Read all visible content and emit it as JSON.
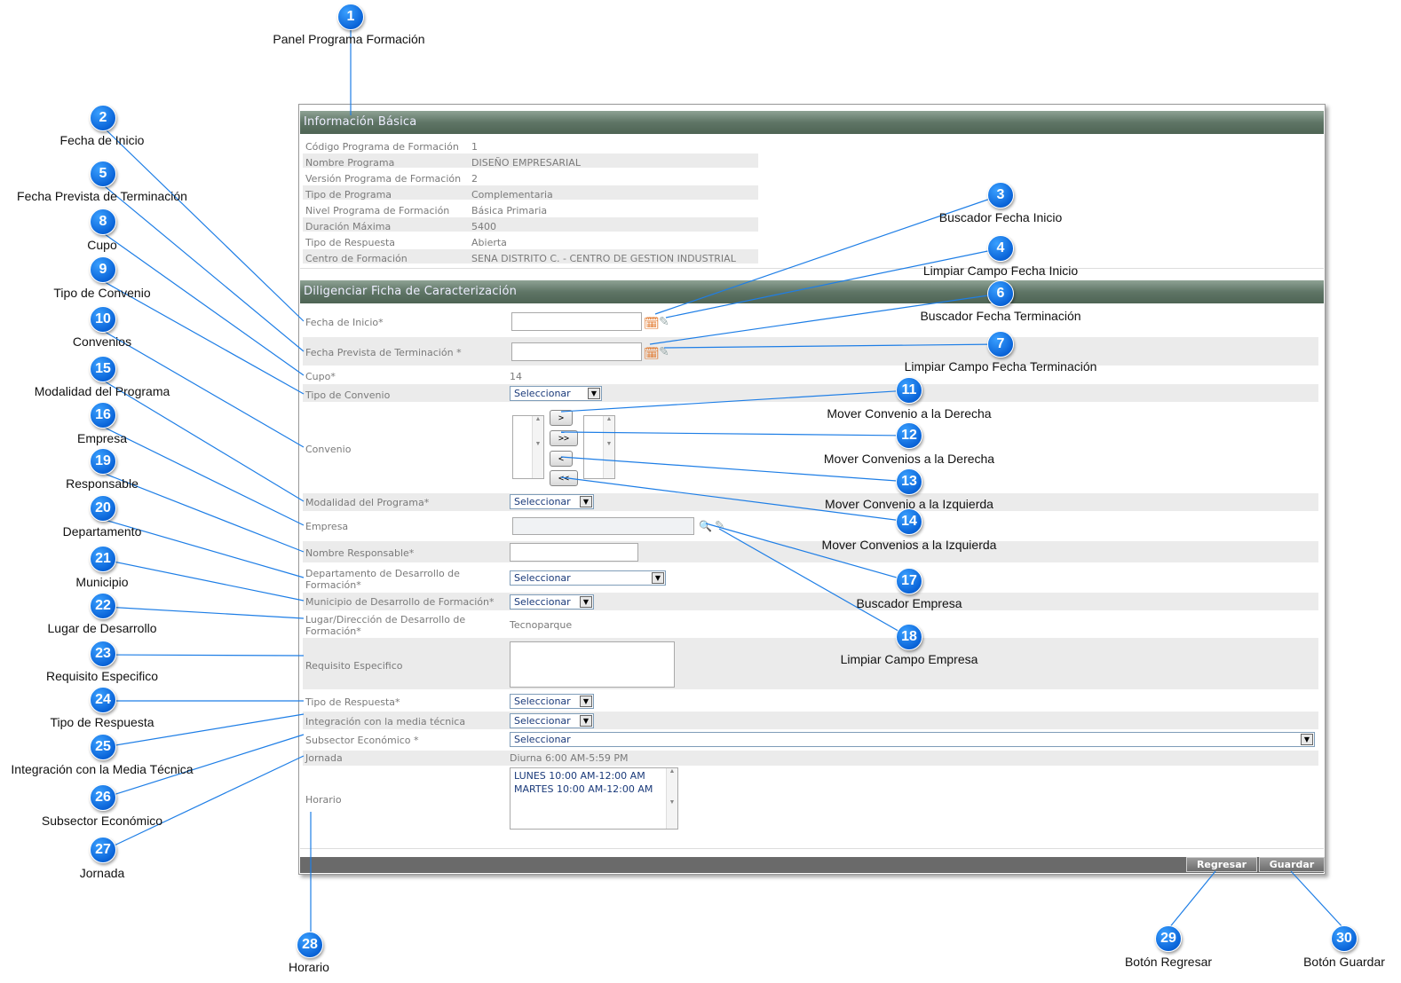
{
  "callouts": [
    {
      "n": "1",
      "label": "Panel Programa Formación"
    },
    {
      "n": "2",
      "label": "Fecha de Inicio"
    },
    {
      "n": "3",
      "label": "Buscador Fecha Inicio"
    },
    {
      "n": "4",
      "label": "Limpiar Campo Fecha Inicio"
    },
    {
      "n": "5",
      "label": "Fecha Prevista de Terminación"
    },
    {
      "n": "6",
      "label": "Buscador Fecha Terminación"
    },
    {
      "n": "7",
      "label": "Limpiar Campo Fecha Terminación"
    },
    {
      "n": "8",
      "label": "Cupo"
    },
    {
      "n": "9",
      "label": "Tipo de Convenio"
    },
    {
      "n": "10",
      "label": "Convenios"
    },
    {
      "n": "11",
      "label": "Mover Convenio a la Derecha"
    },
    {
      "n": "12",
      "label": "Mover Convenios a la Derecha"
    },
    {
      "n": "13",
      "label": "Mover Convenio a la Izquierda"
    },
    {
      "n": "14",
      "label": "Mover Convenios a la Izquierda"
    },
    {
      "n": "15",
      "label": "Modalidad del Programa"
    },
    {
      "n": "16",
      "label": "Empresa"
    },
    {
      "n": "17",
      "label": "Buscador Empresa"
    },
    {
      "n": "18",
      "label": "Limpiar Campo Empresa"
    },
    {
      "n": "19",
      "label": "Responsable"
    },
    {
      "n": "20",
      "label": "Departamento"
    },
    {
      "n": "21",
      "label": "Municipio"
    },
    {
      "n": "22",
      "label": "Lugar de Desarrollo"
    },
    {
      "n": "23",
      "label": "Requisito Especifico"
    },
    {
      "n": "24",
      "label": "Tipo de Respuesta"
    },
    {
      "n": "25",
      "label": "Integración con la Media Técnica"
    },
    {
      "n": "26",
      "label": "Subsector Económico"
    },
    {
      "n": "27",
      "label": "Jornada"
    },
    {
      "n": "28",
      "label": "Horario"
    },
    {
      "n": "29",
      "label": "Botón Regresar"
    },
    {
      "n": "30",
      "label": "Botón Guardar"
    }
  ],
  "basic_info": {
    "title": "Información Básica",
    "rows": [
      {
        "label": "Código Programa de Formación",
        "value": "1"
      },
      {
        "label": "Nombre Programa",
        "value": "DISEÑO EMPRESARIAL"
      },
      {
        "label": "Versión Programa de Formación",
        "value": "2"
      },
      {
        "label": "Tipo de Programa",
        "value": "Complementaria"
      },
      {
        "label": "Nivel Programa de Formación",
        "value": "Básica Primaria"
      },
      {
        "label": "Duración Máxima",
        "value": "5400"
      },
      {
        "label": "Tipo de Respuesta",
        "value": "Abierta"
      },
      {
        "label": "Centro de Formación",
        "value": "SENA DISTRITO C. - CENTRO DE GESTION INDUSTRIAL"
      }
    ]
  },
  "form": {
    "title": "Diligenciar Ficha de Caracterización",
    "fecha_inicio_label": "Fecha de Inicio*",
    "fecha_fin_label": "Fecha Prevista de Terminación *",
    "cupo_label": "Cupo*",
    "cupo_value": "14",
    "tipo_convenio_label": "Tipo de Convenio",
    "convenio_label": "Convenio",
    "move_right": ">",
    "move_all_right": ">>",
    "move_left": "<",
    "move_all_left": "<<",
    "modalidad_label": "Modalidad del Programa*",
    "empresa_label": "Empresa",
    "responsable_label": "Nombre Responsable*",
    "departamento_label_1": "Departamento de Desarrollo de",
    "departamento_label_2": "Formación*",
    "municipio_label": "Municipio de Desarrollo de Formación*",
    "lugar_label_1": "Lugar/Dirección de Desarrollo de",
    "lugar_label_2": "Formación*",
    "lugar_value": "Tecnoparque",
    "requisito_label": "Requisito Especifico",
    "tipo_respuesta_label": "Tipo de Respuesta*",
    "integracion_label": "Integración con la media técnica",
    "subsector_label": "Subsector Económico *",
    "jornada_label": "Jornada",
    "jornada_value": "Diurna 6:00 AM-5:59 PM",
    "horario_label": "Horario",
    "horario_lines": [
      "LUNES 10:00 AM-12:00 AM",
      "MARTES 10:00 AM-12:00 AM"
    ],
    "select_placeholder": "Seleccionar"
  },
  "footer": {
    "back_label": "Regresar",
    "save_label": "Guardar"
  },
  "icons": [
    "calendar-icon",
    "eraser-icon",
    "search-icon"
  ],
  "colors": {
    "badge": "#0a64d8",
    "header": "#5f7566",
    "callout_line": "#1e7ee6"
  }
}
